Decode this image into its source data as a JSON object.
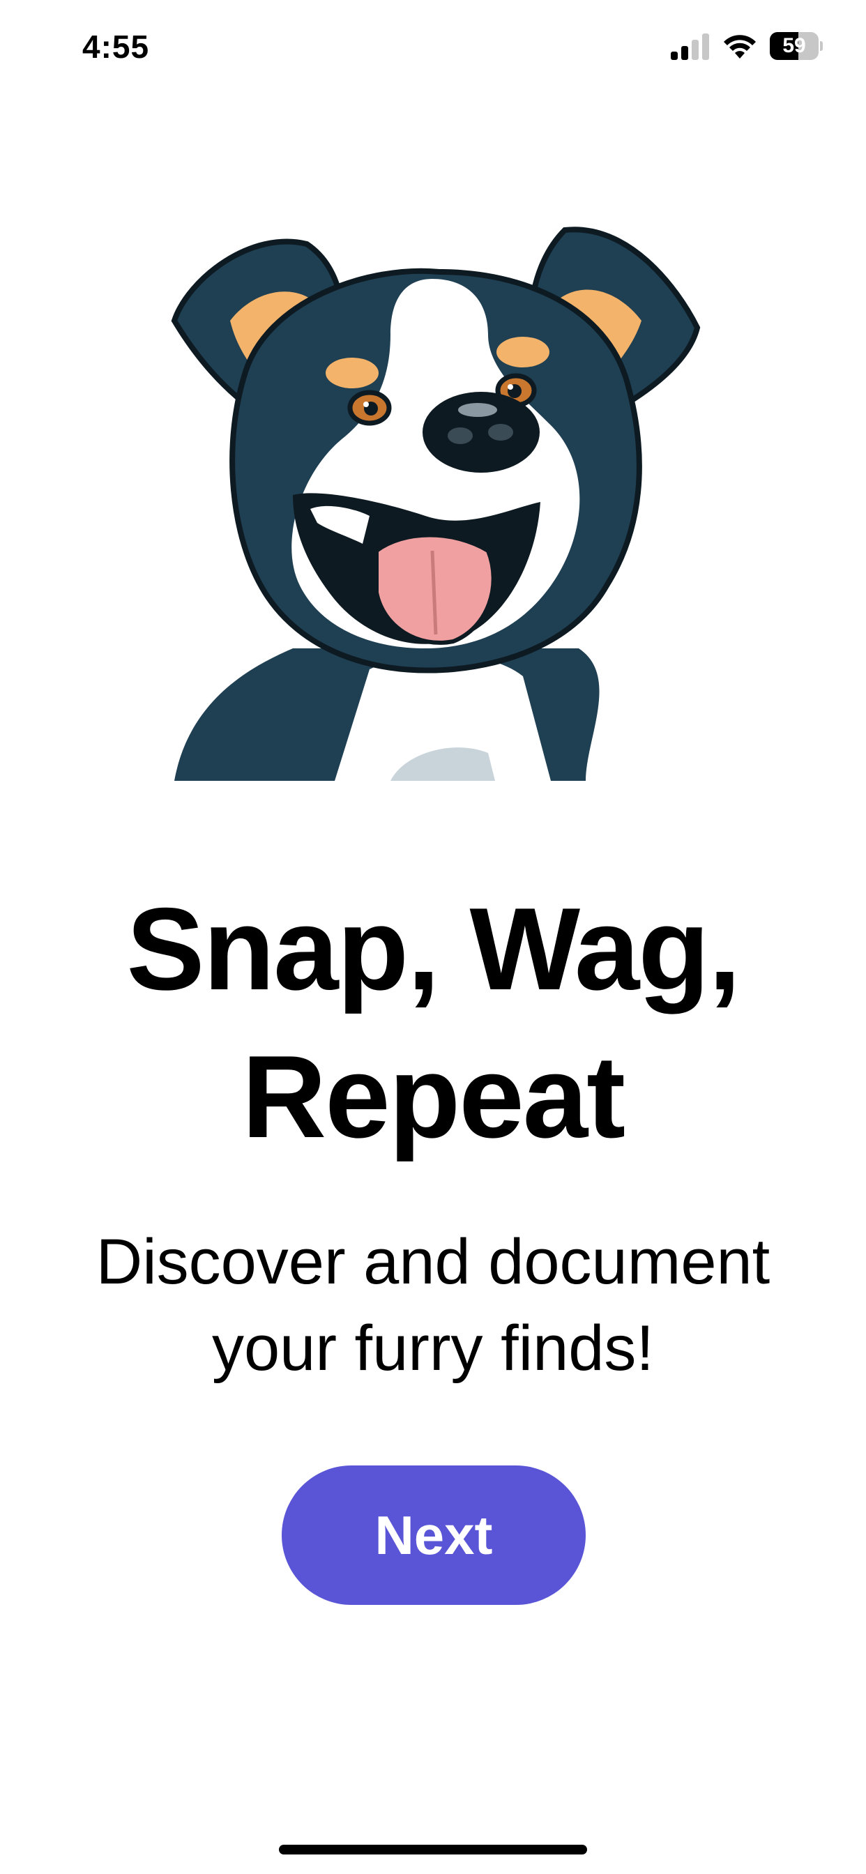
{
  "status_bar": {
    "time": "4:55",
    "battery_percent": 59,
    "battery_label": "59",
    "signal_bars_active": 2,
    "signal_bars_total": 4,
    "icons": [
      "cellular-signal-icon",
      "wifi-icon",
      "battery-icon"
    ]
  },
  "hero": {
    "image": "cartoon-dog-illustration"
  },
  "onboarding": {
    "headline_line1": "Snap, Wag,",
    "headline_line2": "Repeat",
    "subtitle_line1": "Discover and document",
    "subtitle_line2": "your furry finds!",
    "next_label": "Next"
  },
  "colors": {
    "accent": "#5a55d6",
    "background": "#ffffff",
    "text": "#000000",
    "dog_fur_dark": "#1f3f52",
    "dog_ear_inner": "#f3b36a",
    "dog_tongue": "#f0a0a0"
  }
}
